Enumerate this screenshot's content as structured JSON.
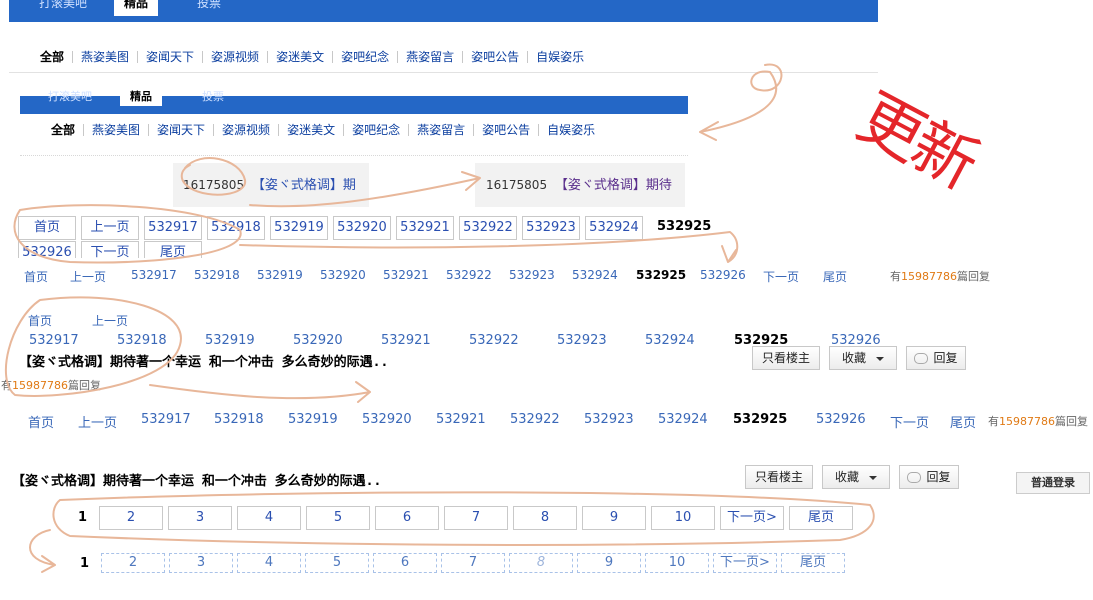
{
  "top_tabs": [
    ""
  ],
  "tabs": [
    {
      "label": "打滚美吧"
    },
    {
      "label": "精品"
    },
    {
      "label": "投票"
    }
  ],
  "subnav_items": [
    "全部",
    "燕姿美图",
    "姿闻天下",
    "姿源视频",
    "姿迷美文",
    "姿吧纪念",
    "燕姿留言",
    "姿吧公告",
    "自娱姿乐"
  ],
  "snippet": {
    "id": "16175805",
    "title": "【姿ヾ式格调】期",
    "title_b": "【姿ヾ式格调】期待"
  },
  "pager": {
    "first": "首页",
    "prev": "上一页",
    "next": "下一页",
    "last": "尾页",
    "pages": [
      "532917",
      "532918",
      "532919",
      "532920",
      "532921",
      "532922",
      "532923",
      "532924",
      "532925",
      "532926"
    ],
    "current": "532925"
  },
  "reply": {
    "prefix": "有",
    "count": "15987786",
    "suffix": "篇回复"
  },
  "thread_title": "【姿ヾ式格调】期待著一个幸运 和一个冲击 多么奇妙的际遇..",
  "buttons": {
    "only_op": "只看楼主",
    "favorite": "收藏",
    "reply": "回复"
  },
  "bottom_pager": {
    "current": "1",
    "pages": [
      "2",
      "3",
      "4",
      "5",
      "6",
      "7",
      "8",
      "9",
      "10"
    ],
    "next": "下一页>",
    "last": "尾页"
  },
  "login": "普通登录",
  "annotation": "更新"
}
